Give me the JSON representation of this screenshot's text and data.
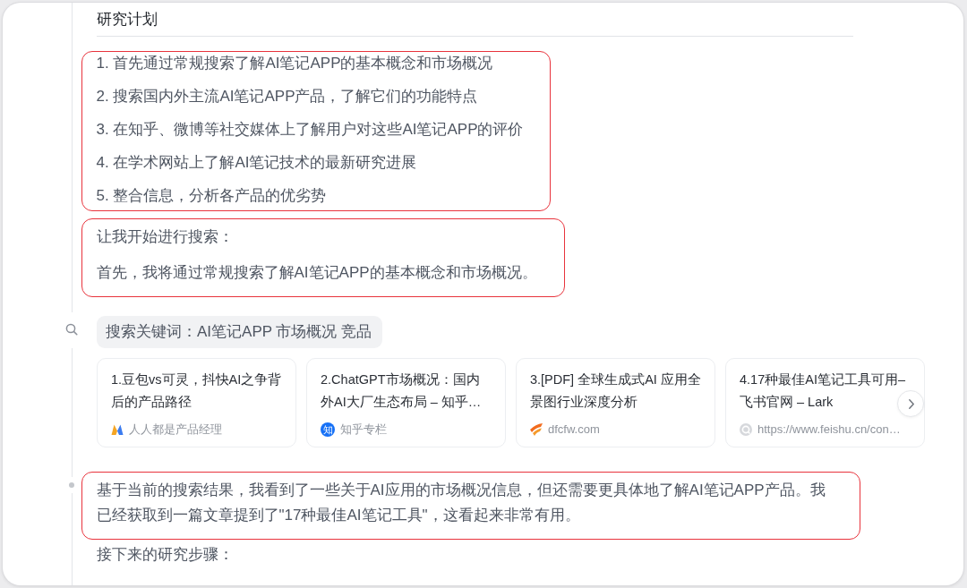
{
  "blocks": [
    {
      "kind": "heading",
      "text": "研究计划",
      "highlighted": false,
      "timeline_dot": false
    },
    {
      "kind": "steps",
      "items": [
        "1. 首先通过常规搜索了解AI笔记APP的基本概念和市场概况",
        "2. 搜索国内外主流AI笔记APP产品，了解它们的功能特点",
        "3. 在知乎、微博等社交媒体上了解用户对这些AI笔记APP的评价",
        "4. 在学术网站上了解AI笔记技术的最新研究进展",
        "5. 整合信息，分析各产品的优劣势"
      ],
      "highlighted": true,
      "timeline_dot": false
    },
    {
      "kind": "text",
      "paragraphs": [
        "让我开始进行搜索：",
        "首先，我将通过常规搜索了解AI笔记APP的基本概念和市场概况。"
      ],
      "highlighted": true,
      "timeline_dot": false
    },
    {
      "kind": "search",
      "query": "搜索关键词：AI笔记APP 市场概况 竞品",
      "highlighted": false,
      "timeline_dot": false,
      "results": [
        {
          "kind": "bars",
          "title": "1.豆包vs可灵，抖快AI之争背后的产品路径",
          "source": "人人都是产品经理"
        },
        {
          "kind": "letter",
          "favicon_text": "知",
          "title": "2.ChatGPT市场概况：国内外AI大厂生态布局 – 知乎…",
          "source": "知乎专栏"
        },
        {
          "kind": "swoosh",
          "title": "3.[PDF] 全球生成式AI 应用全景图行业深度分析",
          "source": "dfcfw.com"
        },
        {
          "kind": "ring",
          "title": "4.17种最佳AI笔记工具可用–飞书官网 – Lark",
          "source": "https://www.feishu.cn/con…"
        }
      ]
    },
    {
      "kind": "text",
      "paragraphs": [
        "基于当前的搜索结果，我看到了一些关于AI应用的市场概况信息，但还需要更具体地了解AI笔记APP产品。我已经获取到一篇文章提到了\"17种最佳AI笔记工具\"，这看起来非常有用。"
      ],
      "highlighted": true,
      "timeline_dot": true
    },
    {
      "kind": "text",
      "paragraphs": [
        "接下来的研究步骤："
      ],
      "highlighted": false,
      "timeline_dot": false
    }
  ]
}
